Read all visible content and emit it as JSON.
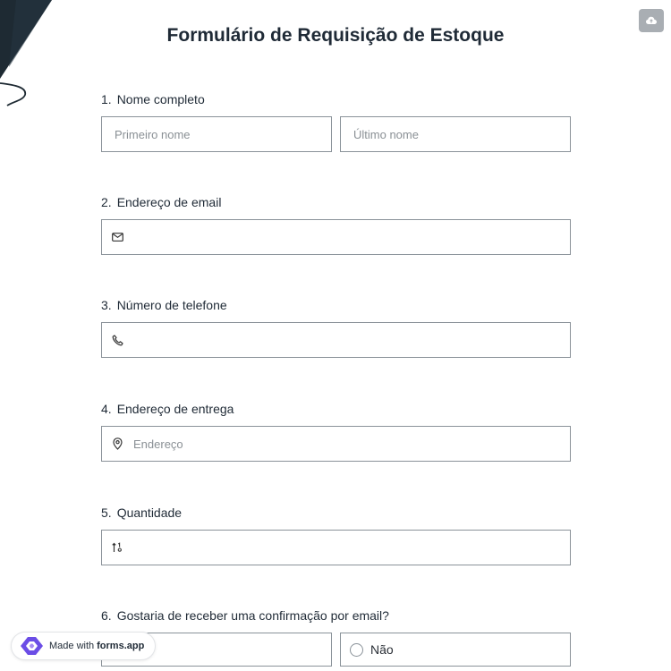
{
  "form": {
    "title": "Formulário de Requisição de Estoque"
  },
  "questions": [
    {
      "number": "1.",
      "label": "Nome completo",
      "fields": [
        {
          "placeholder": "Primeiro nome",
          "icon": ""
        },
        {
          "placeholder": "Último nome",
          "icon": ""
        }
      ]
    },
    {
      "number": "2.",
      "label": "Endereço de email",
      "fields": [
        {
          "placeholder": "",
          "icon": "mail-icon"
        }
      ]
    },
    {
      "number": "3.",
      "label": "Número de telefone",
      "fields": [
        {
          "placeholder": "",
          "icon": "phone-icon"
        }
      ]
    },
    {
      "number": "4.",
      "label": "Endereço de entrega",
      "fields": [
        {
          "placeholder": "Endereço",
          "icon": "map-pin-icon"
        }
      ]
    },
    {
      "number": "5.",
      "label": "Quantidade",
      "fields": [
        {
          "placeholder": "",
          "icon": "number-sort-icon"
        }
      ]
    },
    {
      "number": "6.",
      "label": "Gostaria de receber uma confirmação por email?",
      "options": [
        "",
        "Não"
      ]
    }
  ],
  "badge": {
    "prefix": "Made with",
    "brand": "forms.app"
  },
  "colors": {
    "title": "#1f2a36",
    "border": "#8a9299",
    "cloud_button": "#a9aeb3",
    "brand_purple": "#6b4de6"
  }
}
